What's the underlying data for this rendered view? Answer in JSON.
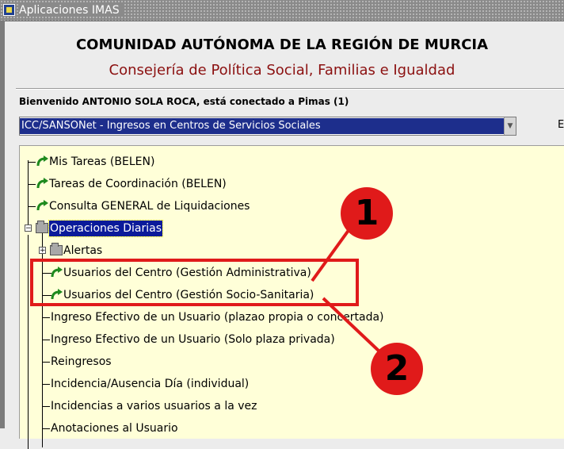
{
  "window": {
    "title": "Aplicaciones IMAS"
  },
  "header": {
    "title": "COMUNIDAD AUTÓNOMA DE LA REGIÓN DE MURCIA",
    "subtitle": "Consejería de Política Social, Familias e Igualdad"
  },
  "welcome": "Bienvenido ANTONIO SOLA ROCA, está conectado a Pimas (1)",
  "app_select": {
    "value": "ICC/SANSONet - Ingresos en Centros de Servicios Sociales"
  },
  "side_text": "E",
  "tree": {
    "items": [
      {
        "label": "Mis Tareas (BELEN)"
      },
      {
        "label": "Tareas de Coordinación (BELEN)"
      },
      {
        "label": "Consulta GENERAL de Liquidaciones"
      },
      {
        "label": "Operaciones Diarias",
        "selected": true
      },
      {
        "label": "Alertas"
      },
      {
        "label": "Usuarios del Centro (Gestión Administrativa)"
      },
      {
        "label": "Usuarios del Centro (Gestión Socio-Sanitaria)"
      },
      {
        "label": "Ingreso Efectivo de un Usuario (plazao propia o concertada)"
      },
      {
        "label": "Ingreso Efectivo de un Usuario (Solo plaza privada)"
      },
      {
        "label": "Reingresos"
      },
      {
        "label": "Incidencia/Ausencia Día (individual)"
      },
      {
        "label": "Incidencias a varios usuarios a la vez"
      },
      {
        "label": "Anotaciones al Usuario"
      }
    ]
  },
  "annotations": {
    "badge_1": "1",
    "badge_2": "2",
    "color": "#e01a1a"
  }
}
